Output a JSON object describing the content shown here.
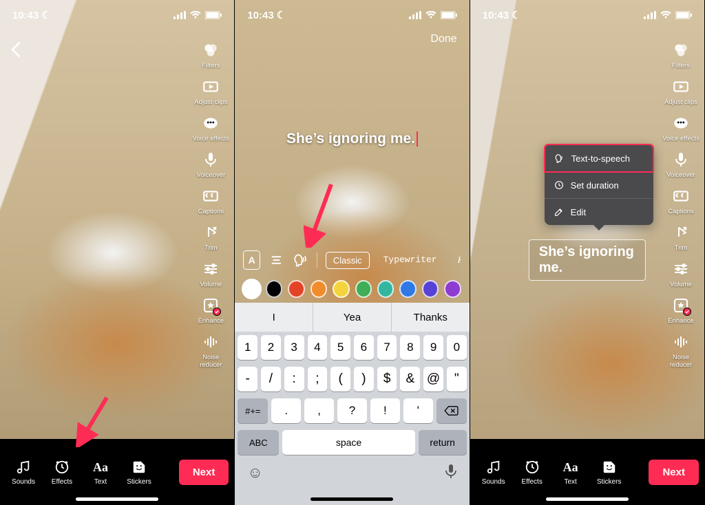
{
  "status": {
    "time": "10:43",
    "moon": "☾"
  },
  "screen1": {
    "tools": [
      {
        "label": "Filters"
      },
      {
        "label": "Adjust clips"
      },
      {
        "label": "Voice effects"
      },
      {
        "label": "Voiceover"
      },
      {
        "label": "Captions"
      },
      {
        "label": "Trim"
      },
      {
        "label": "Volume"
      },
      {
        "label": "Enhance"
      },
      {
        "label": "Noise reducer"
      }
    ],
    "bottom": {
      "sounds": "Sounds",
      "effects": "Effects",
      "text": "Text",
      "stickers": "Stickers",
      "next": "Next"
    }
  },
  "screen2": {
    "done": "Done",
    "typed_text": "She’s ignoring me.",
    "font_chips": [
      "Classic",
      "Typewriter",
      "Han"
    ],
    "suggestions": [
      "I",
      "Yea",
      "Thanks"
    ],
    "num_row": [
      "1",
      "2",
      "3",
      "4",
      "5",
      "6",
      "7",
      "8",
      "9",
      "0"
    ],
    "sym_row": [
      "-",
      "/",
      ":",
      ";",
      "(",
      ")",
      "$",
      "&",
      "@",
      "\""
    ],
    "punc_row": [
      ".",
      ",",
      "?",
      "!",
      "'"
    ],
    "numshift": "#+=",
    "abc": "ABC",
    "space": "space",
    "ret": "return",
    "colors": [
      "#ffffff",
      "#000000",
      "#e34326",
      "#f08c2b",
      "#f5d33c",
      "#3fae57",
      "#32b6a0",
      "#2f79e6",
      "#5742d6",
      "#8e3bd1"
    ]
  },
  "screen3": {
    "text": "She’s ignoring me.",
    "popup": {
      "tts": "Text-to-speech",
      "duration": "Set duration",
      "edit": "Edit"
    }
  }
}
